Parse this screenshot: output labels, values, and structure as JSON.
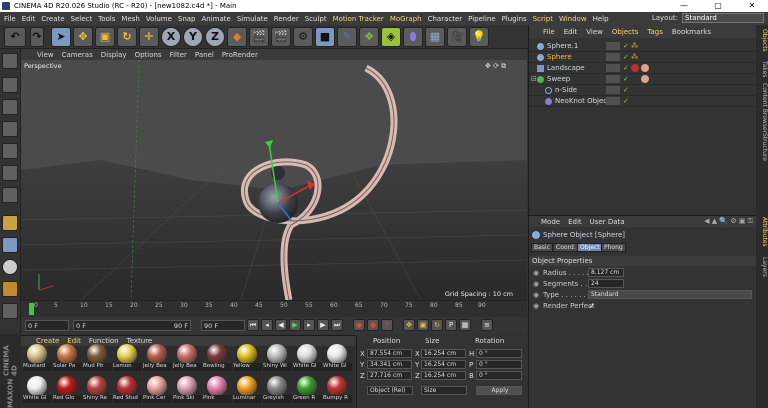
{
  "window": {
    "title": "CINEMA 4D R20.026 Studio (RC - R20) - [new1082.c4d *] - Main",
    "min_glyph": "—",
    "max_glyph": "▢",
    "close_glyph": "✕"
  },
  "menu": {
    "items": [
      "File",
      "Edit",
      "Create",
      "Select",
      "Tools",
      "Mesh",
      "Volume",
      "Snap",
      "Animate",
      "Simulate",
      "Render",
      "Sculpt",
      "Motion Tracker",
      "MoGraph",
      "Character",
      "Pipeline",
      "Plugins",
      "Script",
      "Window",
      "Help"
    ],
    "layout_label": "Layout:",
    "layout_value": "Standard"
  },
  "toolbar": {
    "axis_x": "X",
    "axis_y": "Y",
    "axis_z": "Z",
    "coord_p": "P"
  },
  "viewport": {
    "menu": [
      "View",
      "Cameras",
      "Display",
      "Options",
      "Filter",
      "Panel",
      "ProRender"
    ],
    "label": "Perspective",
    "grid_spacing": "Grid Spacing : 10 cm"
  },
  "timeline": {
    "ticks": [
      "0",
      "5",
      "10",
      "15",
      "20",
      "25",
      "30",
      "35",
      "40",
      "45",
      "50",
      "55",
      "60",
      "65",
      "70",
      "75",
      "80",
      "85",
      "90"
    ],
    "current_frame": "0 F",
    "start_frame": "0 F",
    "end_field": "90 F",
    "end_frame": "90 F"
  },
  "materials": {
    "menu": [
      "Create",
      "Edit",
      "Function",
      "Texture"
    ],
    "top_row": [
      "Mustard",
      "Solar Pa",
      "Mud Pit",
      "Lemon",
      "Jelly Bea",
      "Jelly Bea",
      "Bowling",
      "Yellow",
      "Shiny Wi",
      "White Gl",
      "White Gl"
    ],
    "bottom_row": [
      "White Gl",
      "Red Glo",
      "Shiny Re",
      "Red Stud",
      "Pink Cer",
      "Pink Ski",
      "Pink",
      "Luminar",
      "Greyish",
      "Green R",
      "Bumpy R"
    ],
    "brand_top": "MAXON",
    "brand_bottom": "CINEMA 4D"
  },
  "coords": {
    "headers": [
      "Position",
      "Size",
      "Rotation"
    ],
    "rows": [
      {
        "axis": "X",
        "pos": "87.554 cm",
        "size_axis": "X",
        "size": "16.254 cm",
        "rot_axis": "H",
        "rot": "0 °"
      },
      {
        "axis": "Y",
        "pos": "34.341 cm",
        "size_axis": "Y",
        "size": "16.254 cm",
        "rot_axis": "P",
        "rot": "0 °"
      },
      {
        "axis": "Z",
        "pos": "27.716 cm",
        "size_axis": "Z",
        "size": "16.254 cm",
        "rot_axis": "B",
        "rot": "0 °"
      }
    ],
    "mode": "Object (Rel)",
    "size_mode": "Size",
    "apply": "Apply"
  },
  "objects": {
    "menu": [
      "File",
      "Edit",
      "View",
      "Objects",
      "Tags",
      "Bookmarks"
    ],
    "items": [
      {
        "name": "Sphere.1",
        "selected": false
      },
      {
        "name": "Sphere",
        "selected": true
      },
      {
        "name": "Landscape",
        "selected": false
      },
      {
        "name": "Sweep",
        "selected": false
      },
      {
        "name": "n-Side",
        "selected": false
      },
      {
        "name": "NeoKnot Object",
        "selected": false
      }
    ]
  },
  "attributes": {
    "menu": [
      "Mode",
      "Edit",
      "User Data"
    ],
    "title": "Sphere Object [Sphere]",
    "tabs": [
      "Basic",
      "Coord.",
      "Object",
      "Phong"
    ],
    "active_tab": "Object",
    "section": "Object Properties",
    "radius_label": "Radius . . . . . . .",
    "radius": "8.127 cm",
    "segments_label": "Segments . . . . .",
    "segments": "24",
    "type_label": "Type . . . . . . . . .",
    "type": "Standard",
    "render_perfect_label": "Render Perfect",
    "render_perfect": "✓"
  },
  "right_tabs": [
    "Objects",
    "Takes",
    "Content Browser",
    "Structure",
    "Attributes",
    "Layers"
  ]
}
